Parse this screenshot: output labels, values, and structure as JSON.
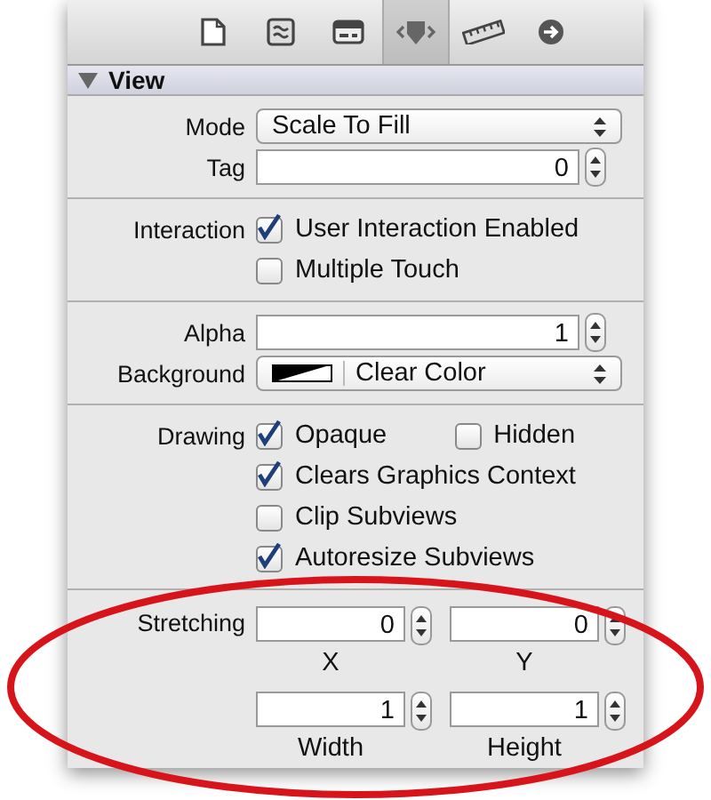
{
  "toolbar": {
    "tabs": [
      {
        "kind": "file",
        "selected": false
      },
      {
        "kind": "wave",
        "selected": false
      },
      {
        "kind": "card",
        "selected": false
      },
      {
        "kind": "shield",
        "selected": true
      },
      {
        "kind": "ruler",
        "selected": false
      },
      {
        "kind": "arrow",
        "selected": false
      }
    ]
  },
  "section": {
    "title": "View",
    "expanded": true
  },
  "mode": {
    "label": "Mode",
    "value": "Scale To Fill"
  },
  "tag": {
    "label": "Tag",
    "value": "0"
  },
  "interaction": {
    "label": "Interaction",
    "options": [
      {
        "label": "User Interaction Enabled",
        "checked": true
      },
      {
        "label": "Multiple Touch",
        "checked": false
      }
    ]
  },
  "alpha": {
    "label": "Alpha",
    "value": "1"
  },
  "background": {
    "label": "Background",
    "value": "Clear Color"
  },
  "drawing": {
    "label": "Drawing",
    "rows": [
      [
        {
          "label": "Opaque",
          "checked": true
        },
        {
          "label": "Hidden",
          "checked": false
        }
      ],
      [
        {
          "label": "Clears Graphics Context",
          "checked": true
        }
      ],
      [
        {
          "label": "Clip Subviews",
          "checked": false
        }
      ],
      [
        {
          "label": "Autoresize Subviews",
          "checked": true
        }
      ]
    ]
  },
  "stretching": {
    "label": "Stretching",
    "fields": [
      {
        "value": "0",
        "caption": "X"
      },
      {
        "value": "0",
        "caption": "Y"
      },
      {
        "value": "1",
        "caption": "Width"
      },
      {
        "value": "1",
        "caption": "Height"
      }
    ]
  }
}
